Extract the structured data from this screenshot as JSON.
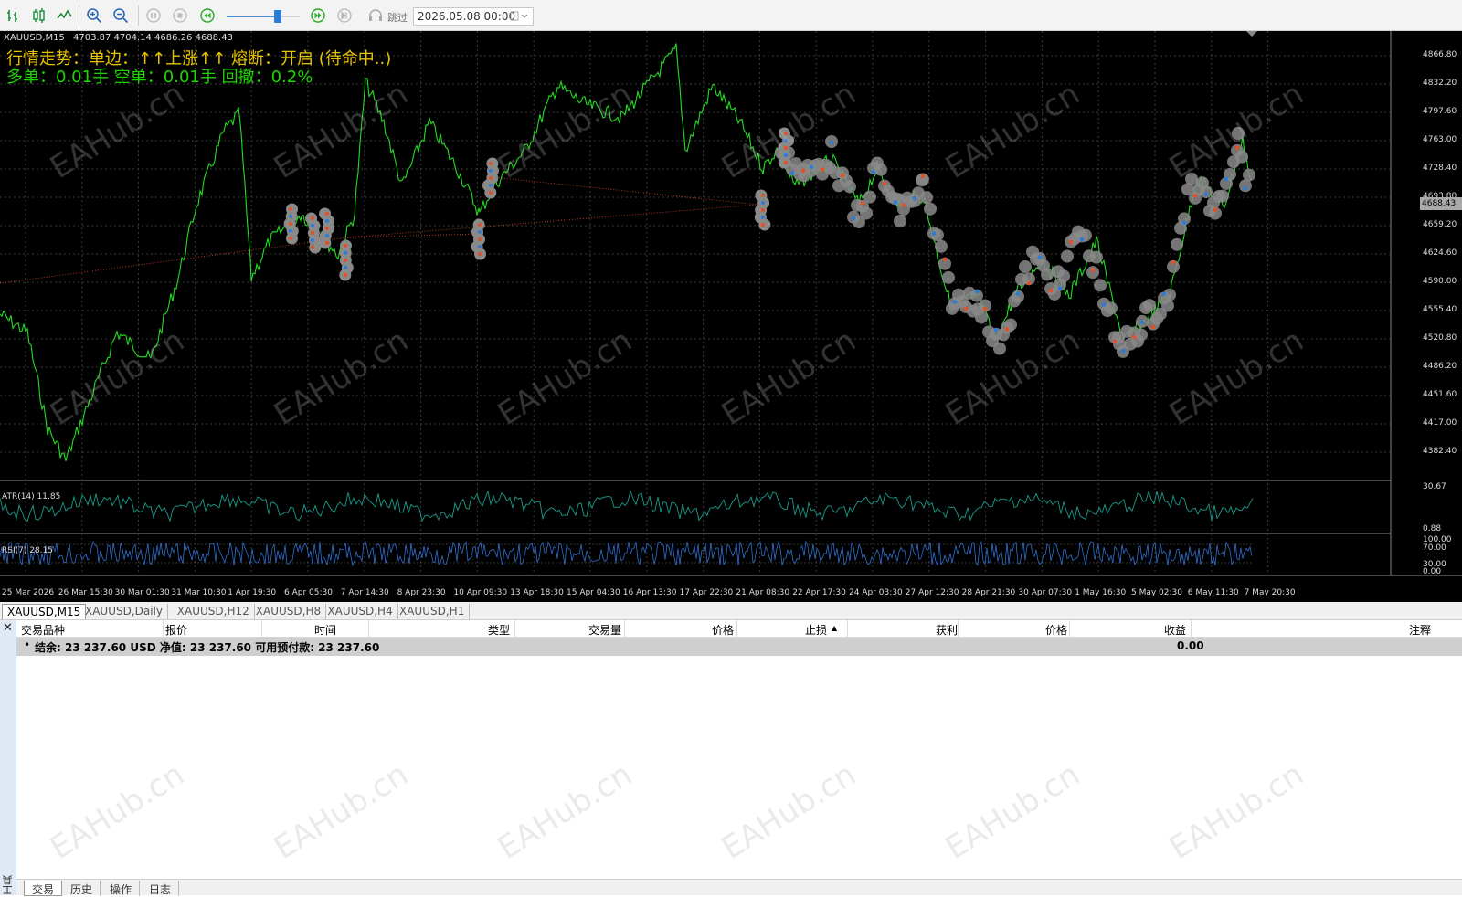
{
  "toolbar": {
    "icons": [
      "bar-chart-icon",
      "candlestick-icon",
      "line-chart-icon",
      "zoom-in-icon",
      "zoom-out-icon",
      "pause-icon",
      "stop-icon",
      "rewind-icon",
      "fast-forward-icon",
      "skip-end-icon",
      "headset-icon"
    ],
    "skip_label": "跳过",
    "date_value": "2026.05.08 00:00"
  },
  "chart": {
    "symbol": "XAUUSD,M15",
    "ohlc": "4703.87 4704.14 4686.26 4688.43",
    "trend_text": "行情走势：单边：↑↑上涨↑↑    熔断：开启 (待命中..)",
    "position_text": "多单：0.01手    空单：0.01手    回撤：0.2%",
    "price_ticks": [
      "4866.80",
      "4832.20",
      "4797.60",
      "4763.00",
      "4728.40",
      "4693.80",
      "4659.20",
      "4624.60",
      "4590.00",
      "4555.40",
      "4520.80",
      "4486.20",
      "4451.60",
      "4417.00",
      "4382.40"
    ],
    "current_price": "4688.43",
    "atr_label": "ATR(14) 11.85",
    "atr_ticks": [
      "30.67",
      "0.88"
    ],
    "rsi_label": "RSI(7) 28.15",
    "rsi_ticks": [
      "100.00",
      "70.00",
      "30.00",
      "0.00"
    ],
    "time_ticks": [
      "25 Mar 2026",
      "26 Mar 15:30",
      "30 Mar 01:30",
      "31 Mar 10:30",
      "1 Apr 19:30",
      "6 Apr 05:30",
      "7 Apr 14:30",
      "8 Apr 23:30",
      "10 Apr 09:30",
      "13 Apr 18:30",
      "15 Apr 04:30",
      "16 Apr 13:30",
      "17 Apr 22:30",
      "21 Apr 08:30",
      "22 Apr 17:30",
      "24 Apr 03:30",
      "27 Apr 12:30",
      "28 Apr 21:30",
      "30 Apr 07:30",
      "1 May 16:30",
      "5 May 02:30",
      "6 May 11:30",
      "7 May 20:30"
    ],
    "colors": {
      "price_line": "#22dd22",
      "grid": "#3a3a3a",
      "trend_text": "#e8c400",
      "position_text": "#1ed400",
      "atr": "#1a9c8c",
      "rsi": "#2f6fd0",
      "marker_fill": "#8a8a8a",
      "buy_marker": "#2f7cd6",
      "sell_marker": "#e0522a"
    }
  },
  "chart_tabs": [
    "XAUUSD,M15",
    "XAUUSD,Daily",
    "XAUUSD,H12",
    "XAUUSD,H8",
    "XAUUSD,H4",
    "XAUUSD,H1"
  ],
  "terminal": {
    "side_label": "工具箱",
    "columns": [
      "交易品种",
      "报价",
      "时间",
      "类型",
      "交易量",
      "价格",
      "止损",
      "获利",
      "价格",
      "收益",
      "注释"
    ],
    "balance_text": "结余: 23 237.60 USD  净值: 23 237.60  可用预付款: 23 237.60",
    "profit": "0.00",
    "tabs": [
      "交易",
      "历史",
      "操作",
      "日志"
    ]
  },
  "watermark": "EAHub.cn"
}
